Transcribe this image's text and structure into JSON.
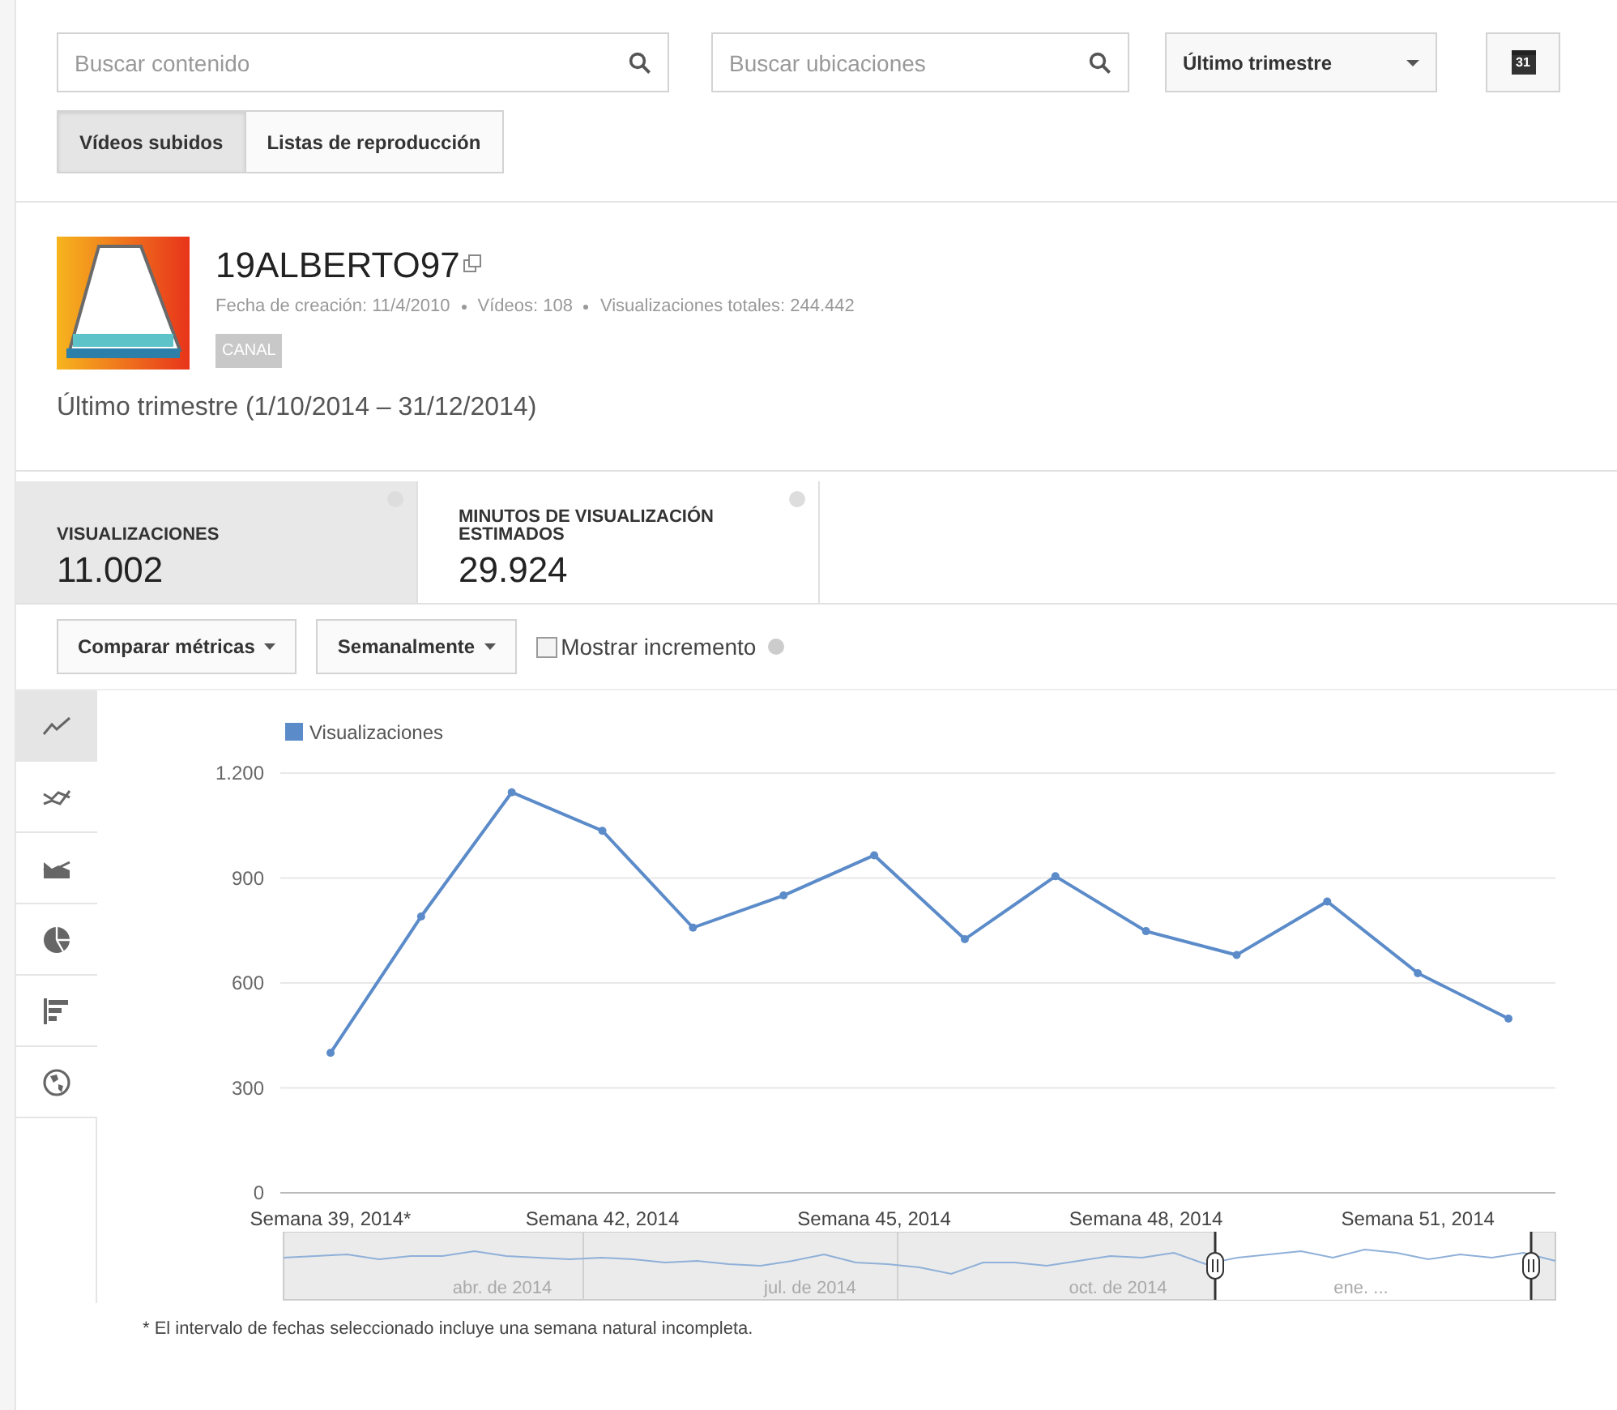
{
  "search_content": {
    "placeholder": "Buscar contenido"
  },
  "search_locations": {
    "placeholder": "Buscar ubicaciones"
  },
  "period_dropdown": {
    "value": "Último trimestre"
  },
  "calendar_button": {
    "label": "31"
  },
  "tabs": [
    {
      "label": "Vídeos subidos",
      "selected": true
    },
    {
      "label": "Listas de reproducción",
      "selected": false
    }
  ],
  "channel": {
    "name": "19ALBERTO97",
    "meta": [
      "Fecha de creación: 11/4/2010",
      "Vídeos: 108",
      "Visualizaciones totales: 244.442"
    ],
    "badge": "CANAL"
  },
  "period_title": "Último trimestre (1/10/2014 – 31/12/2014)",
  "metrics": [
    {
      "label": "VISUALIZACIONES",
      "value": "11.002",
      "selected": true
    },
    {
      "label": "MINUTOS DE VISUALIZACIÓN ESTIMADOS",
      "value": "29.924",
      "selected": false
    }
  ],
  "toolbar": {
    "compare": "Comparar métricas",
    "interval": "Semanalmente",
    "show_increment": {
      "label": "Mostrar incremento",
      "checked": false
    }
  },
  "chart_types": [
    {
      "kind": "line",
      "selected": true
    },
    {
      "kind": "multiline",
      "selected": false
    },
    {
      "kind": "area",
      "selected": false
    },
    {
      "kind": "pie",
      "selected": false
    },
    {
      "kind": "bar",
      "selected": false
    },
    {
      "kind": "map",
      "selected": false
    }
  ],
  "chart": {
    "chart_data": {
      "type": "line",
      "categories": [
        "Semana 39, 2014*",
        null,
        null,
        "Semana 42, 2014",
        null,
        null,
        "Semana 45, 2014",
        null,
        null,
        "Semana 48, 2014",
        null,
        null,
        "Semana 51, 2014",
        null
      ],
      "grid": true,
      "series": [
        {
          "name": "Visualizaciones",
          "color": "#5b8bc9",
          "marker": true,
          "values": [
            400,
            790,
            1145,
            1035,
            758,
            850,
            965,
            725,
            905,
            748,
            680,
            833,
            628,
            498
          ]
        }
      ],
      "ylim": [
        0,
        1200
      ],
      "yticks": [
        {
          "value": 0,
          "label": "0"
        },
        {
          "value": 300,
          "label": "300"
        },
        {
          "value": 600,
          "label": "600"
        },
        {
          "value": 900,
          "label": "900"
        },
        {
          "value": 1200,
          "label": "1.200"
        }
      ]
    }
  },
  "navigator": {
    "labels": [
      "abr. de 2014",
      "jul. de 2014",
      "oct. de 2014",
      "ene. ..."
    ]
  },
  "footnote": "* El intervalo de fechas seleccionado incluye una semana natural incompleta."
}
